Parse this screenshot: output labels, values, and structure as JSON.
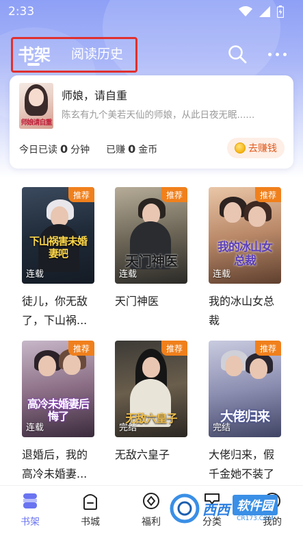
{
  "status_bar": {
    "time": "2:33"
  },
  "header": {
    "tab_shelf": "书架",
    "tab_history": "阅读历史"
  },
  "current_book": {
    "title": "师娘，请自重",
    "description": "陈玄有九个美若天仙的师娘，从此日夜无眠......",
    "cover_art_text": "师娘请自重",
    "read_label": "今日已读",
    "read_value": "0",
    "read_unit": "分钟",
    "earned_label": "已赚",
    "earned_value": "0",
    "earned_unit": "金币",
    "earn_button": "去赚钱"
  },
  "books": [
    {
      "name": "徒儿，你无敌了，下山祸...",
      "tag": "推荐",
      "status": "连载",
      "cover_text": "下山祸害未婚妻吧"
    },
    {
      "name": "天门神医",
      "tag": "推荐",
      "status": "连载",
      "cover_text": "天门神医"
    },
    {
      "name": "我的冰山女总裁",
      "tag": "推荐",
      "status": "连载",
      "cover_text": "我的冰山女总裁"
    },
    {
      "name": "退婚后，我的高冷未婚妻...",
      "tag": "推荐",
      "status": "连载",
      "cover_text": "高冷未婚妻后悔了"
    },
    {
      "name": "无敌六皇子",
      "tag": "推荐",
      "status": "完结",
      "cover_text": "无敌六皇子"
    },
    {
      "name": "大佬归来，假千金她不装了",
      "tag": "推荐",
      "status": "完结",
      "cover_text": "大佬归来"
    }
  ],
  "bottom_nav": [
    {
      "label": "书架",
      "icon": "bookshelf-icon",
      "active": true
    },
    {
      "label": "书城",
      "icon": "bookstore-icon"
    },
    {
      "label": "福利",
      "icon": "welfare-icon"
    },
    {
      "label": "分类",
      "icon": "category-icon"
    },
    {
      "label": "我的",
      "icon": "profile-icon"
    }
  ],
  "watermark": {
    "brand": "西西",
    "sub": "软件园",
    "url": "CR173.COM"
  },
  "colors": {
    "accent": "#6a74f0",
    "tag_orange": "#f0801c",
    "highlight_box": "#e0302f",
    "earn_text": "#e05a1c"
  }
}
